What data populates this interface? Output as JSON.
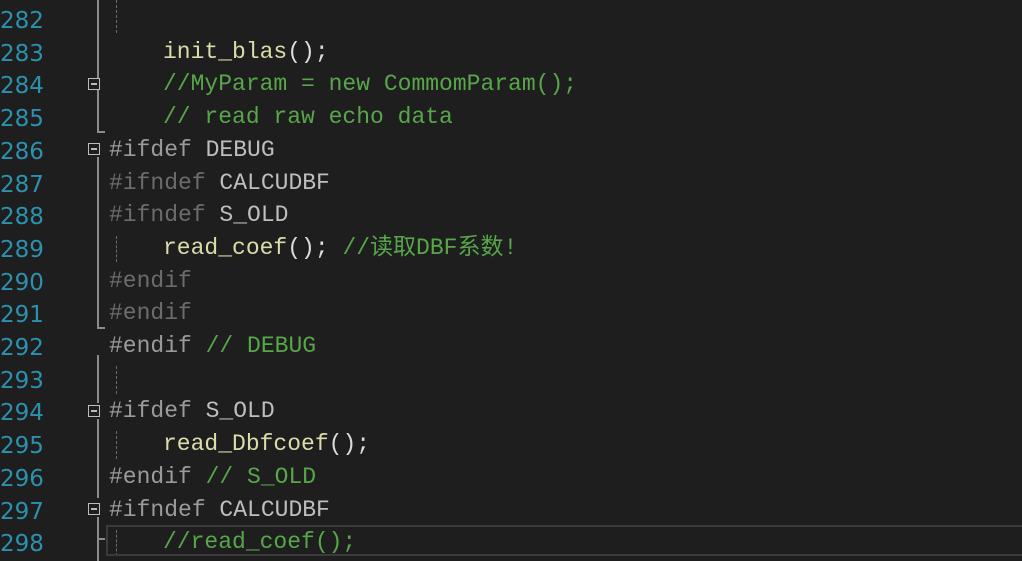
{
  "editor": {
    "lines": [
      {
        "number": "282",
        "indent": 0,
        "tokens": []
      },
      {
        "number": "283",
        "indent": 1,
        "tokens": [
          {
            "text": "init_blas",
            "type": "func"
          },
          {
            "text": "();",
            "type": "default"
          }
        ]
      },
      {
        "number": "284",
        "indent": 1,
        "tokens": [
          {
            "text": "//MyParam = new CommomParam();",
            "type": "comment"
          }
        ]
      },
      {
        "number": "285",
        "indent": 1,
        "tokens": [
          {
            "text": "// read raw echo data",
            "type": "comment"
          }
        ]
      },
      {
        "number": "286",
        "indent": 0,
        "tokens": [
          {
            "text": "#ifdef",
            "type": "preproc"
          },
          {
            "text": " DEBUG",
            "type": "macro"
          }
        ]
      },
      {
        "number": "287",
        "indent": 0,
        "tokens": [
          {
            "text": "#ifndef",
            "type": "inactive"
          },
          {
            "text": " CALCUDBF",
            "type": "macro"
          }
        ]
      },
      {
        "number": "288",
        "indent": 0,
        "tokens": [
          {
            "text": "#ifndef",
            "type": "inactive"
          },
          {
            "text": " S_OLD",
            "type": "macro"
          }
        ]
      },
      {
        "number": "289",
        "indent": 1,
        "tokens": [
          {
            "text": "read_coef",
            "type": "func"
          },
          {
            "text": "(); ",
            "type": "default"
          },
          {
            "text": "//读取DBF系数!",
            "type": "comment"
          }
        ]
      },
      {
        "number": "290",
        "indent": 0,
        "tokens": [
          {
            "text": "#endif",
            "type": "inactive"
          }
        ]
      },
      {
        "number": "291",
        "indent": 0,
        "tokens": [
          {
            "text": "#endif",
            "type": "inactive"
          }
        ]
      },
      {
        "number": "292",
        "indent": 0,
        "tokens": [
          {
            "text": "#endif",
            "type": "preproc"
          },
          {
            "text": " // DEBUG",
            "type": "comment"
          }
        ]
      },
      {
        "number": "293",
        "indent": 0,
        "tokens": []
      },
      {
        "number": "294",
        "indent": 0,
        "tokens": [
          {
            "text": "#ifdef",
            "type": "preproc"
          },
          {
            "text": " S_OLD",
            "type": "macro"
          }
        ]
      },
      {
        "number": "295",
        "indent": 1,
        "tokens": [
          {
            "text": "read_Dbfcoef",
            "type": "func"
          },
          {
            "text": "();",
            "type": "default"
          }
        ]
      },
      {
        "number": "296",
        "indent": 0,
        "tokens": [
          {
            "text": "#endif",
            "type": "preproc"
          },
          {
            "text": " // S_OLD",
            "type": "comment"
          }
        ]
      },
      {
        "number": "297",
        "indent": 0,
        "tokens": [
          {
            "text": "#ifndef",
            "type": "preproc"
          },
          {
            "text": " CALCUDBF",
            "type": "macro"
          }
        ]
      },
      {
        "number": "298",
        "indent": 1,
        "tokens": [
          {
            "text": "//read_coef();",
            "type": "comment"
          }
        ]
      }
    ],
    "fold_icon": "collapse-minus-icon",
    "colors": {
      "background": "#1e1e1e",
      "line_number": "#2b91af",
      "comment": "#57a64a",
      "function": "#dcdcaa",
      "preprocessor": "#9b9b9b",
      "inactive": "#6c6c6c"
    }
  }
}
